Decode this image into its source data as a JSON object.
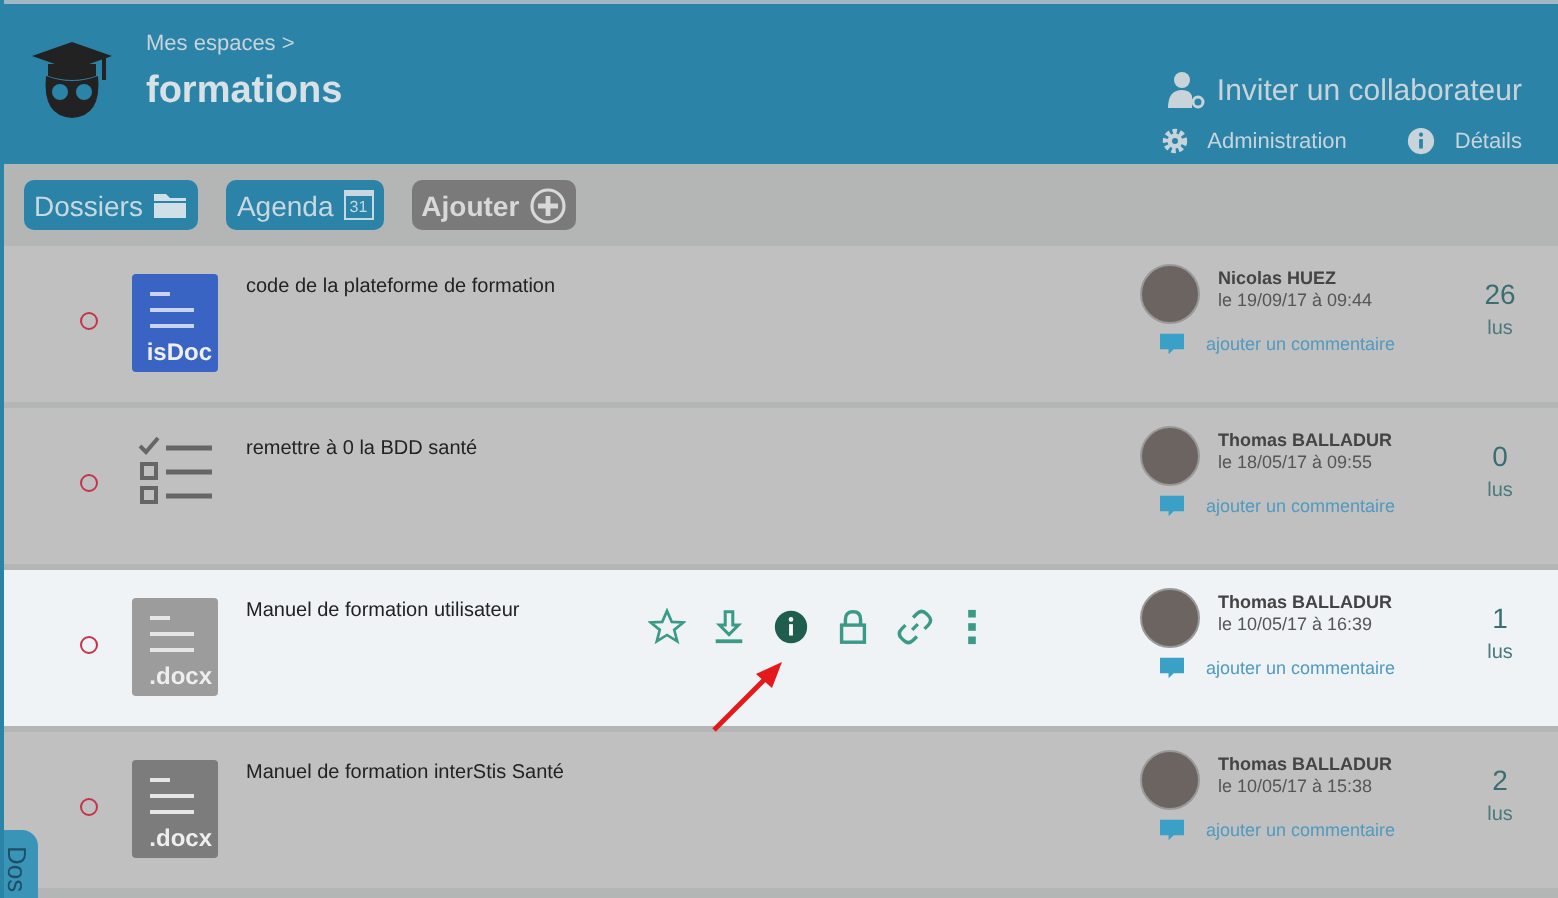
{
  "header": {
    "breadcrumb": "Mes espaces >",
    "title": "formations",
    "invite": "Inviter un collaborateur",
    "links": [
      {
        "kind": "settings",
        "label": "Administration"
      },
      {
        "kind": "info",
        "label": "Détails"
      }
    ]
  },
  "toolbar": [
    {
      "kind": "folder",
      "label": "Dossiers"
    },
    {
      "kind": "calendar",
      "label": "Agenda",
      "badge": "31"
    },
    {
      "kind": "add",
      "label": "Ajouter"
    }
  ],
  "rows": [
    {
      "kind": "isdoc",
      "icon_label": "isDoc",
      "title": "code de la plateforme de formation",
      "author": "Nicolas HUEZ",
      "date": "le 19/09/17 à 09:44",
      "comment": "ajouter un commentaire",
      "count": "26",
      "count_label": "lus",
      "highlighted": false
    },
    {
      "kind": "checklist",
      "title": "remettre à 0 la BDD santé",
      "author": "Thomas BALLADUR",
      "date": "le 18/05/17 à 09:55",
      "comment": "ajouter un commentaire",
      "count": "0",
      "count_label": "lus",
      "highlighted": false
    },
    {
      "kind": "docx",
      "icon_label": ".docx",
      "title": "Manuel de formation utilisateur",
      "author": "Thomas BALLADUR",
      "date": "le 10/05/17 à 16:39",
      "comment": "ajouter un commentaire",
      "count": "1",
      "count_label": "lus",
      "highlighted": true
    },
    {
      "kind": "docx",
      "icon_label": ".docx",
      "title": "Manuel de formation interStis Santé",
      "author": "Thomas BALLADUR",
      "date": "le 10/05/17 à 15:38",
      "comment": "ajouter un commentaire",
      "count": "2",
      "count_label": "lus",
      "highlighted": false
    }
  ],
  "side_tab": "Dos"
}
